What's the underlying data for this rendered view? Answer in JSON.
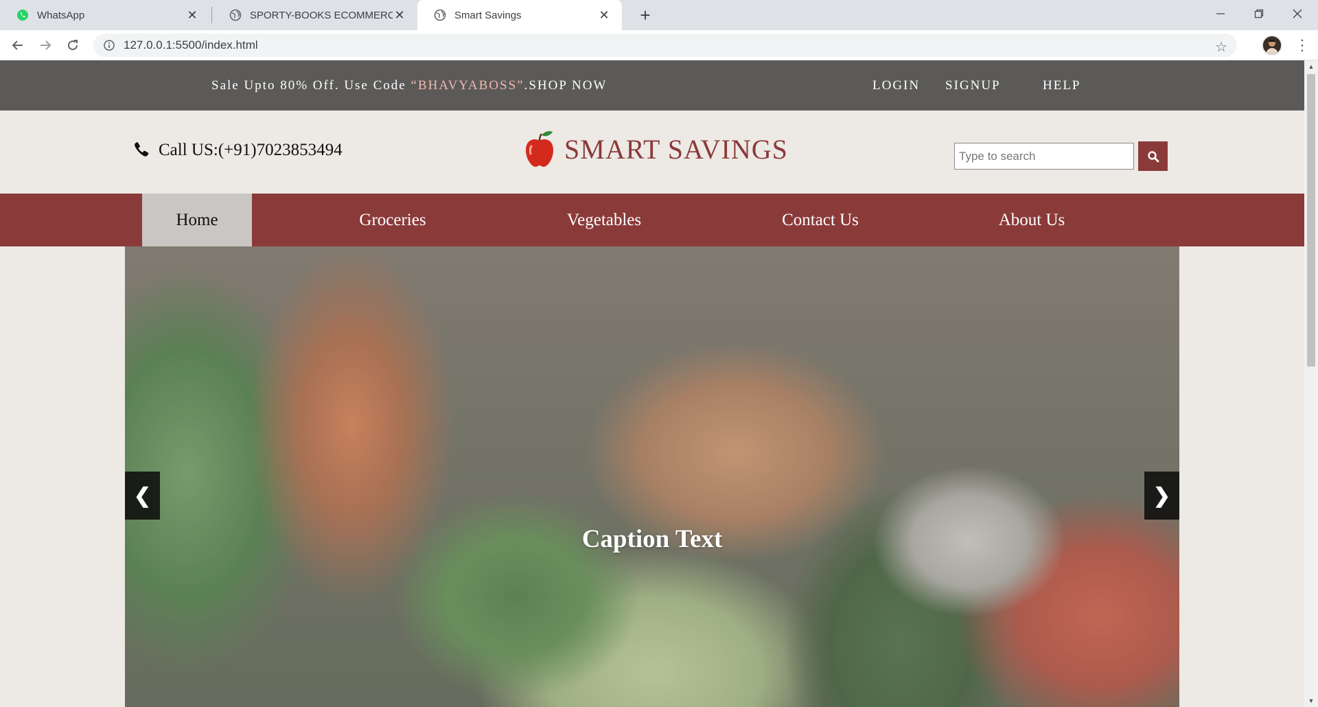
{
  "browser": {
    "tabs": [
      {
        "title": "WhatsApp",
        "icon": "whatsapp-icon"
      },
      {
        "title": "SPORTY-BOOKS ECOMMERCE",
        "icon": "globe-icon"
      },
      {
        "title": "Smart Savings",
        "icon": "globe-icon",
        "active": true
      }
    ],
    "url": "127.0.0.1:5500/index.html"
  },
  "promo": {
    "prefix": "Sale Upto 80% Off. Use Code ",
    "code": "“BHAVYABOSS”",
    "suffix": ".SHOP NOW",
    "links": [
      "LOGIN",
      "SIGNUP",
      "HELP"
    ]
  },
  "header": {
    "phone": "Call US:(+91)7023853494",
    "brand": "SMART SAVINGS",
    "search_placeholder": "Type to search"
  },
  "nav": {
    "items": [
      "Home",
      "Groceries",
      "Vegetables",
      "Contact Us",
      "About Us"
    ],
    "active": "Home"
  },
  "slider": {
    "caption": "Caption Text",
    "prev": "❮",
    "next": "❯"
  },
  "colors": {
    "brand": "#8b3a3a",
    "promo_bg": "#5b5a58",
    "page_bg": "#ede9e4",
    "code": "#f5b7b1"
  }
}
